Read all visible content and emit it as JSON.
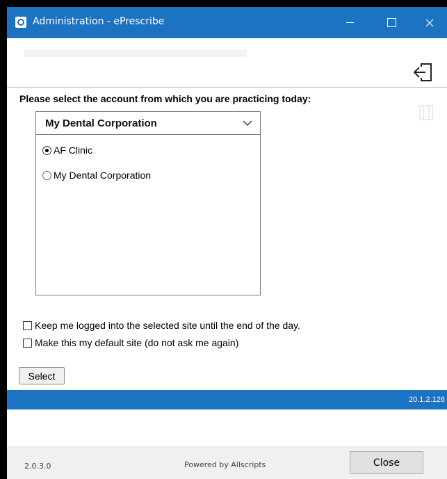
{
  "window": {
    "title": "Administration - ePrescribe",
    "title_bar_color": "#1c73c1",
    "icon": "eprescribe-app-icon",
    "controls": [
      "minimize-icon",
      "maximize-icon",
      "close-icon"
    ]
  },
  "header": {
    "logout_icon": "sign-out-icon"
  },
  "main": {
    "prompt": "Please select the account from which you are practicing today:",
    "account_dropdown": {
      "selected": "My Dental Corporation",
      "icon": "chevron-down-icon"
    },
    "sites": [
      {
        "label": "AF Clinic",
        "checked": true
      },
      {
        "label": "My Dental Corporation",
        "checked": false
      }
    ],
    "options": [
      {
        "label": "Keep me logged into the selected site until the end of the day.",
        "checked": false
      },
      {
        "label": "Make this my default site (do not ask me again)",
        "checked": false
      }
    ],
    "select_button": "Select"
  },
  "version_bar": {
    "server_version": "20.1.2.126",
    "color": "#1c73c1"
  },
  "footer": {
    "client_version": "2.0.3.0",
    "powered_by": "Powered by Allscripts",
    "close_button": "Close"
  }
}
